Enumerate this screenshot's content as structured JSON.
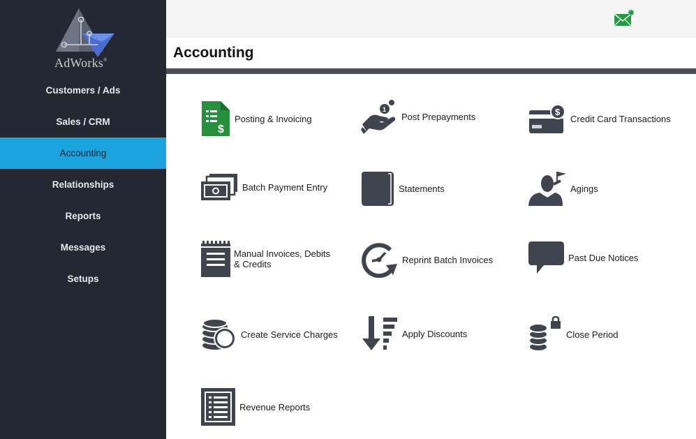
{
  "app": {
    "logo_text": "AdWorks",
    "logo_mark": "®"
  },
  "sidebar": {
    "items": [
      {
        "label": "Customers / Ads",
        "active": false
      },
      {
        "label": "Sales / CRM",
        "active": false
      },
      {
        "label": "Accounting",
        "active": true
      },
      {
        "label": "Relationships",
        "active": false
      },
      {
        "label": "Reports",
        "active": false
      },
      {
        "label": "Messages",
        "active": false
      },
      {
        "label": "Setups",
        "active": false
      }
    ]
  },
  "header": {
    "mail_icon": "envelope-notification-icon",
    "page_title": "Accounting"
  },
  "tiles": [
    {
      "label": "Posting & Invoicing",
      "icon": "invoice-document-icon"
    },
    {
      "label": "Post Prepayments",
      "icon": "hand-coin-icon"
    },
    {
      "label": "Credit Card Transactions",
      "icon": "credit-card-dollar-icon"
    },
    {
      "label": "Batch Payment Entry",
      "icon": "cash-stack-icon"
    },
    {
      "label": "Statements",
      "icon": "book-icon"
    },
    {
      "label": "Agings",
      "icon": "person-flag-icon"
    },
    {
      "label": "Manual Invoices, Debits & Credits",
      "icon": "notepad-icon"
    },
    {
      "label": "Reprint Batch Invoices",
      "icon": "clock-refresh-icon"
    },
    {
      "label": "Past Due Notices",
      "icon": "speech-bubble-icon"
    },
    {
      "label": "Create Service Charges",
      "icon": "coin-stack-icon"
    },
    {
      "label": "Apply Discounts",
      "icon": "sort-descending-icon"
    },
    {
      "label": "Close Period",
      "icon": "database-lock-icon"
    },
    {
      "label": "Revenue Reports",
      "icon": "report-list-icon"
    }
  ],
  "colors": {
    "sidebar_bg": "#242833",
    "active_nav": "#1aa3dd",
    "icon_dark": "#3f444f",
    "icon_green": "#27903c",
    "mail_green": "#1e9e3e"
  }
}
